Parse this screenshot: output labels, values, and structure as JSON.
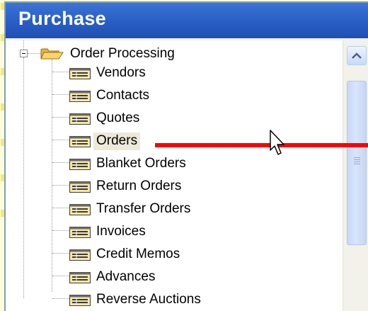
{
  "window": {
    "title": "Purchase"
  },
  "tree": {
    "root": {
      "label": "Order Processing",
      "expanded": true
    },
    "items": [
      {
        "label": "Vendors",
        "selected": false
      },
      {
        "label": "Contacts",
        "selected": false
      },
      {
        "label": "Quotes",
        "selected": false
      },
      {
        "label": "Orders",
        "selected": true
      },
      {
        "label": "Blanket Orders",
        "selected": false
      },
      {
        "label": "Return Orders",
        "selected": false
      },
      {
        "label": "Transfer Orders",
        "selected": false
      },
      {
        "label": "Invoices",
        "selected": false
      },
      {
        "label": "Credit Memos",
        "selected": false
      },
      {
        "label": "Advances",
        "selected": false
      },
      {
        "label": "Reverse Auctions",
        "selected": false
      }
    ]
  },
  "colors": {
    "titlebar": "#2a5fc6",
    "selection": "#ece9d8",
    "annotation_arrow": "#ff0000",
    "background": "#fdfbd8"
  },
  "icons": {
    "root": "open-folder-icon",
    "item": "form-icon",
    "expander": "collapse-minus-icon",
    "scroll_up": "scroll-up-arrow-icon",
    "cursor": "mouse-pointer-icon"
  }
}
